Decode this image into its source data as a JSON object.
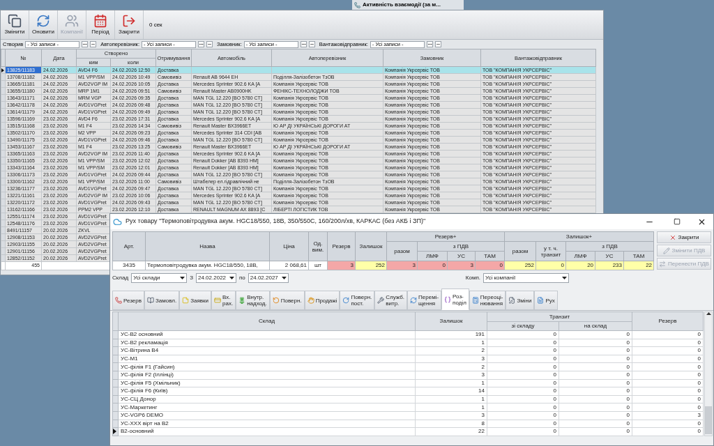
{
  "taskbar_item": {
    "label": "Активність взаємодії (за м..."
  },
  "back_window": {
    "toolbar": [
      {
        "label": "Змінити",
        "disabled": false
      },
      {
        "label": "Оновити",
        "disabled": false
      },
      {
        "label": "Компанії",
        "disabled": true
      },
      {
        "label": "Період",
        "disabled": false
      },
      {
        "label": "Закрити",
        "disabled": false
      }
    ],
    "timer": "0 сек",
    "filters": [
      {
        "label": "Створив",
        "value": "- Усі записи -"
      },
      {
        "label": "Автоперевізник:",
        "value": "- Усі записи -"
      },
      {
        "label": "Замовник:",
        "value": "- Усі записи -"
      },
      {
        "label": "Вантажовідправник:",
        "value": "- Усі записи -"
      }
    ],
    "table": {
      "columns": {
        "number": "№",
        "date": "Дата",
        "created": "Створено",
        "created_by": "ким",
        "created_at": "коли",
        "receiving": "Отримування",
        "vehicle": "Автомобіль",
        "carrier": "Автоперевізник",
        "customer": "Замовник",
        "shipper": "Вантажовідправник"
      },
      "rows": [
        {
          "selected": true,
          "number": "13825/11183",
          "date": "24.02.2026",
          "created_by": "AVD4 F6",
          "created_at": "24.02.2026 12:50",
          "receiving": "Доставка",
          "customer": "Компанія Укрсервіс ТОВ",
          "shipper": "ТОВ \"КОМПАНІЯ УКРСЕРВІС\""
        },
        {
          "selected": false,
          "number": "13708/11182",
          "date": "24.02.2026",
          "created_by": "M1 VPP/SM",
          "created_at": "24.02.2026 10:49",
          "receiving": "Самовивіз",
          "vehicle": "Renault AB 9644 EH",
          "carrier": "Поділля-Залізобетон ТзОВ",
          "customer": "Компанія Укрсервіс ТОВ",
          "shipper": "ТОВ \"КОМПАНІЯ УКРСЕРВІС\""
        },
        {
          "selected": false,
          "number": "13665/11181",
          "date": "24.02.2026",
          "created_by": "AVD2VGP IM",
          "created_at": "24.02.2026 10:05",
          "receiving": "Доставка",
          "vehicle": "Mercedes Sprinter 902.6 KA [A",
          "carrier": "Компанія Укрсервіс ТОВ",
          "customer": "Компанія Укрсервіс ТОВ",
          "shipper": "ТОВ \"КОМПАНІЯ УКРСЕРВІС\""
        },
        {
          "selected": false,
          "number": "13655/11180",
          "date": "24.02.2026",
          "created_by": "MRP 1M1",
          "created_at": "24.02.2026 09:51",
          "receiving": "Самовивіз",
          "vehicle": "Renault Master AB0900HK",
          "carrier": "ФЕНІКС-ТЕХНОЛОДЖИ ТОВ",
          "customer": "Компанія Укрсервіс ТОВ",
          "shipper": "ТОВ \"КОМПАНІЯ УКРСЕРВІС\""
        },
        {
          "selected": false,
          "number": "13643/11171",
          "date": "24.02.2026",
          "created_by": "MRM VGP",
          "created_at": "24.02.2026 09:35",
          "receiving": "Доставка",
          "vehicle": "MAN TGL 12.220 [BO 5780 CT]",
          "carrier": "Компанія Укрсервіс ТОВ",
          "customer": "Компанія Укрсервіс ТОВ",
          "shipper": "ТОВ \"КОМПАНІЯ УКРСЕРВІС\""
        },
        {
          "selected": false,
          "number": "13642/11178",
          "date": "24.02.2026",
          "created_by": "AVD1VGPret",
          "created_at": "24.02.2026 09:48",
          "receiving": "Доставка",
          "vehicle": "MAN TGL 12.220 [BO 5780 CT]",
          "carrier": "Компанія Укрсервіс ТОВ",
          "customer": "Компанія Укрсервіс ТОВ",
          "shipper": "ТОВ \"КОМПАНІЯ УКРСЕРВІС\""
        },
        {
          "selected": false,
          "number": "13614/11179",
          "date": "24.02.2026",
          "created_by": "AVD1VGPret",
          "created_at": "24.02.2026 09:49",
          "receiving": "Доставка",
          "vehicle": "MAN TGL 12.220 [BO 5780 CT]",
          "carrier": "Компанія Укрсервіс ТОВ",
          "customer": "Компанія Укрсервіс ТОВ",
          "shipper": "ТОВ \"КОМПАНІЯ УКРСЕРВІС\""
        },
        {
          "selected": false,
          "number": "13596/11169",
          "date": "23.02.2026",
          "created_by": "AVD4 F6",
          "created_at": "23.02.2026 17:31",
          "receiving": "Доставка",
          "vehicle": "Mercedes Sprinter 902.6 KA [A",
          "carrier": "Компанія Укрсервіс ТОВ",
          "customer": "Компанія Укрсервіс ТОВ",
          "shipper": "ТОВ \"КОМПАНІЯ УКРСЕРВІС\""
        },
        {
          "selected": false,
          "number": "13515/11168",
          "date": "23.02.2026",
          "created_by": "M1 F4",
          "created_at": "23.02.2026 14:34",
          "receiving": "Самовивіз",
          "vehicle": "Renault Master BX3966ET",
          "carrier": "Ю АР ДІ УКРАЇНСЬКІ ДОРОГИ АТ",
          "customer": "Компанія Укрсервіс ТОВ",
          "shipper": "ТОВ \"КОМПАНІЯ УКРСЕРВІС\""
        },
        {
          "selected": false,
          "number": "13502/11170",
          "date": "23.02.2026",
          "created_by": "M2 VPP",
          "created_at": "24.02.2026 09:23",
          "receiving": "Доставка",
          "vehicle": "Mercedes Sprinter 314 CDI [AB",
          "carrier": "Компанія Укрсервіс ТОВ",
          "customer": "Компанія Укрсервіс ТОВ",
          "shipper": "ТОВ \"КОМПАНІЯ УКРСЕРВІС\""
        },
        {
          "selected": false,
          "number": "13490/11175",
          "date": "23.02.2026",
          "created_by": "AVD1VGPret",
          "created_at": "24.02.2026 09:46",
          "receiving": "Доставка",
          "vehicle": "MAN TGL 12.220 [BO 5780 CT]",
          "carrier": "Компанія Укрсервіс ТОВ",
          "customer": "Компанія Укрсервіс ТОВ",
          "shipper": "ТОВ \"КОМПАНІЯ УКРСЕРВІС\""
        },
        {
          "selected": false,
          "number": "13453/11167",
          "date": "23.02.2026",
          "created_by": "M1 F4",
          "created_at": "23.02.2026 13:25",
          "receiving": "Самовивіз",
          "vehicle": "Renault Master BX3966ET",
          "carrier": "Ю АР ДІ УКРАЇНСЬКІ ДОРОГИ АТ",
          "customer": "Компанія Укрсервіс ТОВ",
          "shipper": "ТОВ \"КОМПАНІЯ УКРСЕРВІС\""
        },
        {
          "selected": false,
          "number": "13365/11163",
          "date": "23.02.2026",
          "created_by": "AVD2VGP IM",
          "created_at": "23.02.2026 11:40",
          "receiving": "Доставка",
          "vehicle": "Mercedes Sprinter 902.6 KA [A",
          "carrier": "Компанія Укрсервіс ТОВ",
          "customer": "Компанія Укрсервіс ТОВ",
          "shipper": "ТОВ \"КОМПАНІЯ УКРСЕРВІС\""
        },
        {
          "selected": false,
          "number": "13350/11165",
          "date": "23.02.2026",
          "created_by": "M1 VPP/SM",
          "created_at": "23.02.2026 12:02",
          "receiving": "Доставка",
          "vehicle": "Renault Dokker [AB 8393 HM]",
          "carrier": "Компанія Укрсервіс ТОВ",
          "customer": "Компанія Укрсервіс ТОВ",
          "shipper": "ТОВ \"КОМПАНІЯ УКРСЕРВІС\""
        },
        {
          "selected": false,
          "number": "13343/11164",
          "date": "23.02.2026",
          "created_by": "M1 VPP/SM",
          "created_at": "23.02.2026 12:01",
          "receiving": "Доставка",
          "vehicle": "Renault Dokker [AB 8393 HM]",
          "carrier": "Компанія Укрсервіс ТОВ",
          "customer": "Компанія Укрсервіс ТОВ",
          "shipper": "ТОВ \"КОМПАНІЯ УКРСЕРВІС\""
        },
        {
          "selected": false,
          "number": "13306/11173",
          "date": "23.02.2026",
          "created_by": "AVD1VGPret",
          "created_at": "24.02.2026 09:44",
          "receiving": "Доставка",
          "vehicle": "MAN TGL 12.220 [BO 5780 CT]",
          "carrier": "Компанія Укрсервіс ТОВ",
          "customer": "Компанія Укрсервіс ТОВ",
          "shipper": "ТОВ \"КОМПАНІЯ УКРСЕРВІС\""
        },
        {
          "selected": false,
          "number": "13300/11162",
          "date": "23.02.2026",
          "created_by": "M1 VPP/SM",
          "created_at": "23.02.2026 11:00",
          "receiving": "Самовивіз",
          "vehicle": "Штабелер ел.гідравлічний не",
          "carrier": "Поділля-Залізобетон ТзОВ",
          "customer": "Компанія Укрсервіс ТОВ",
          "shipper": "ТОВ \"КОМПАНІЯ УКРСЕРВІС\""
        },
        {
          "selected": false,
          "number": "13236/11177",
          "date": "23.02.2026",
          "created_by": "AVD1VGPret",
          "created_at": "24.02.2026 09:47",
          "receiving": "Доставка",
          "vehicle": "MAN TGL 12.220 [BO 5780 CT]",
          "carrier": "Компанія Укрсервіс ТОВ",
          "customer": "Компанія Укрсервіс ТОВ",
          "shipper": "ТОВ \"КОМПАНІЯ УКРСЕРВІС\""
        },
        {
          "selected": false,
          "number": "13221/11161",
          "date": "23.02.2026",
          "created_by": "AVD2VGP IM",
          "created_at": "23.02.2026 10:06",
          "receiving": "Доставка",
          "vehicle": "Mercedes Sprinter 902.6 KA [A",
          "carrier": "Компанія Укрсервіс ТОВ",
          "customer": "Компанія Укрсервіс ТОВ",
          "shipper": "ТОВ \"КОМПАНІЯ УКРСЕРВІС\""
        },
        {
          "selected": false,
          "number": "13220/11172",
          "date": "23.02.2026",
          "created_by": "AVD1VGPret",
          "created_at": "24.02.2026 09:43",
          "receiving": "Доставка",
          "vehicle": "MAN TGL 12.220 [BO 5780 CT]",
          "carrier": "Компанія Укрсервіс ТОВ",
          "customer": "Компанія Укрсервіс ТОВ",
          "shipper": "ТОВ \"КОМПАНІЯ УКРСЕРВІС\""
        },
        {
          "selected": false,
          "number": "13162/11166",
          "date": "23.02.2026",
          "created_by": "PPM2 VPP",
          "created_at": "23.02.2026 12:10",
          "receiving": "Доставка",
          "vehicle": "RENAULT MAGNUM  AX 8893 [C",
          "carrier": "ЛІБЕРТІ ЛОГІСТИК ТОВ",
          "customer": "Компанія Укрсервіс ТОВ",
          "shipper": "ТОВ \"КОМПАНІЯ УКРСЕРВІС\""
        },
        {
          "selected": false,
          "number": "12551/11174",
          "date": "23.02.2026",
          "created_by": "AVD1VGPret"
        },
        {
          "selected": false,
          "number": "12548/11176",
          "date": "23.02.2026",
          "created_by": "AVD1VGPret"
        },
        {
          "selected": false,
          "number": "8491/11157",
          "date": "20.02.2026",
          "created_by": "ZKVL"
        },
        {
          "selected": false,
          "number": "12908/11153",
          "date": "20.02.2026",
          "created_by": "AVD2VGPret"
        },
        {
          "selected": false,
          "number": "12903/11155",
          "date": "20.02.2026",
          "created_by": "AVD2VGPret"
        },
        {
          "selected": false,
          "number": "12901/11156",
          "date": "20.02.2026",
          "created_by": "AVD2VGPret"
        },
        {
          "selected": false,
          "number": "12852/11152",
          "date": "20.02.2026",
          "created_by": "AVD2VGPret"
        }
      ],
      "footer_count": "455"
    }
  },
  "front_window": {
    "title": "Рух товару \"Термоповітродувка акум. HGC18/550, 18В, 350/550С, 160/200л/хв, КАРКАС (без АКБ і ЗП)\"",
    "item_table": {
      "headers": {
        "art": "Арт.",
        "name": "Назва",
        "price": "Ціна",
        "unit": "Од. вим.",
        "reserve": "Резерв",
        "stock": "Залишок",
        "reserve_plus": "Резерв+",
        "reserve_total": "разом",
        "reserve_vat": "з ПДВ",
        "reserve_lmf": "ЛМФ",
        "reserve_us": "УС",
        "reserve_tam": "ТАМ",
        "stock_plus": "Залишок+",
        "stock_total": "разом",
        "stock_transit": "у т. ч. транзит",
        "stock_vat": "з ПДВ",
        "stock_lmf": "ЛМФ",
        "stock_us": "УС",
        "stock_tam": "ТАМ"
      },
      "row": [
        {
          "value": "3435"
        },
        {
          "value": "Термоповітродувка акум. HGC18/550, 18В,"
        },
        {
          "value": "2 068,61"
        },
        {
          "value": "шт"
        },
        {
          "value": "3",
          "color": "#f4a7a7"
        },
        {
          "value": "252",
          "color": "#ffffa8"
        },
        {
          "value": "3",
          "color": "#f4a7a7"
        },
        {
          "value": "0",
          "color": "#f4a7a7"
        },
        {
          "value": "3",
          "color": "#f4a7a7"
        },
        {
          "value": "0",
          "color": "#f4a7a7"
        },
        {
          "value": "252",
          "color": "#ffffa8"
        },
        {
          "value": "0",
          "color": "#ffffa8"
        },
        {
          "value": "20",
          "color": "#ffffa8"
        },
        {
          "value": "233",
          "color": "#ffffa8"
        },
        {
          "value": "22",
          "color": "#ffffa8"
        }
      ]
    },
    "side_buttons": [
      {
        "label": "Закрити",
        "disabled": false
      },
      {
        "label": "Змінити ПДВ",
        "disabled": true
      },
      {
        "label": "Перенести ПДВ",
        "disabled": true
      }
    ],
    "filters": {
      "warehouse_label": "Склад",
      "warehouse": "Усі склади",
      "from_label": "З",
      "from": "24.02.2022",
      "to_label": "по",
      "to": "24.02.2027",
      "company_label": "Комп.",
      "company": "Усі компанії"
    },
    "tabs": [
      {
        "label": "Резерв",
        "selected": false
      },
      {
        "label": "Замовл.",
        "selected": false
      },
      {
        "label": "Заявки",
        "selected": false
      },
      {
        "label": "Вх.\nрах.",
        "selected": false
      },
      {
        "label": "Внутр.\nнадход.",
        "selected": false
      },
      {
        "label": "Поверн.",
        "selected": false
      },
      {
        "label": "Продажі",
        "selected": false
      },
      {
        "label": "Поверн.\nпост.",
        "selected": false
      },
      {
        "label": "Служб.\nвитр.",
        "selected": false
      },
      {
        "label": "Перемі-\nщення",
        "selected": false
      },
      {
        "label": "Роз-\nподіл",
        "selected": true
      },
      {
        "label": "Переоці-\nнювання",
        "selected": false
      },
      {
        "label": "Зміни",
        "selected": false
      },
      {
        "label": "Рух",
        "selected": false
      }
    ],
    "grid": {
      "columns": {
        "warehouse": "Склад",
        "stock": "Залишок",
        "transit": "Транзит",
        "from_warehouse": "зі складу",
        "to_warehouse": "на склад",
        "reserve": "Резерв"
      },
      "rows": [
        {
          "selected": false,
          "warehouse": "УС-В2 основний",
          "stock": "191",
          "from_warehouse": "0",
          "to_warehouse": "0",
          "reserve": "0"
        },
        {
          "selected": false,
          "warehouse": "УС-В2 рекламація",
          "stock": "1",
          "from_warehouse": "0",
          "to_warehouse": "0",
          "reserve": "0"
        },
        {
          "selected": false,
          "warehouse": "УС-Вітрина В4",
          "stock": "2",
          "from_warehouse": "0",
          "to_warehouse": "0",
          "reserve": "0"
        },
        {
          "selected": false,
          "warehouse": "УС-М1",
          "stock": "3",
          "from_warehouse": "0",
          "to_warehouse": "0",
          "reserve": "0"
        },
        {
          "selected": false,
          "warehouse": "УС-філія F1 (Гайсин)",
          "stock": "2",
          "from_warehouse": "0",
          "to_warehouse": "0",
          "reserve": "0"
        },
        {
          "selected": false,
          "warehouse": "УС-філія F2 (Іллінці)",
          "stock": "3",
          "from_warehouse": "0",
          "to_warehouse": "0",
          "reserve": "0"
        },
        {
          "selected": false,
          "warehouse": "УС-філія F5 (Хмільник)",
          "stock": "1",
          "from_warehouse": "0",
          "to_warehouse": "0",
          "reserve": "0"
        },
        {
          "selected": false,
          "warehouse": "УС-філія F6 (Київ)",
          "stock": "14",
          "from_warehouse": "0",
          "to_warehouse": "0",
          "reserve": "0"
        },
        {
          "selected": false,
          "warehouse": "УС-СЦ Донор",
          "stock": "1",
          "from_warehouse": "0",
          "to_warehouse": "0",
          "reserve": "0"
        },
        {
          "selected": false,
          "warehouse": "УС-Маркетинг",
          "stock": "1",
          "from_warehouse": "0",
          "to_warehouse": "0",
          "reserve": "0"
        },
        {
          "selected": false,
          "warehouse": "УС-VGP6 DEMO",
          "stock": "3",
          "from_warehouse": "0",
          "to_warehouse": "0",
          "reserve": "3"
        },
        {
          "selected": false,
          "warehouse": "УС-XXX вірт на В2",
          "stock": "8",
          "from_warehouse": "0",
          "to_warehouse": "0",
          "reserve": "0"
        },
        {
          "selected": true,
          "warehouse": "В2-основний",
          "stock": "22",
          "from_warehouse": "0",
          "to_warehouse": "0",
          "reserve": "0"
        }
      ]
    }
  }
}
